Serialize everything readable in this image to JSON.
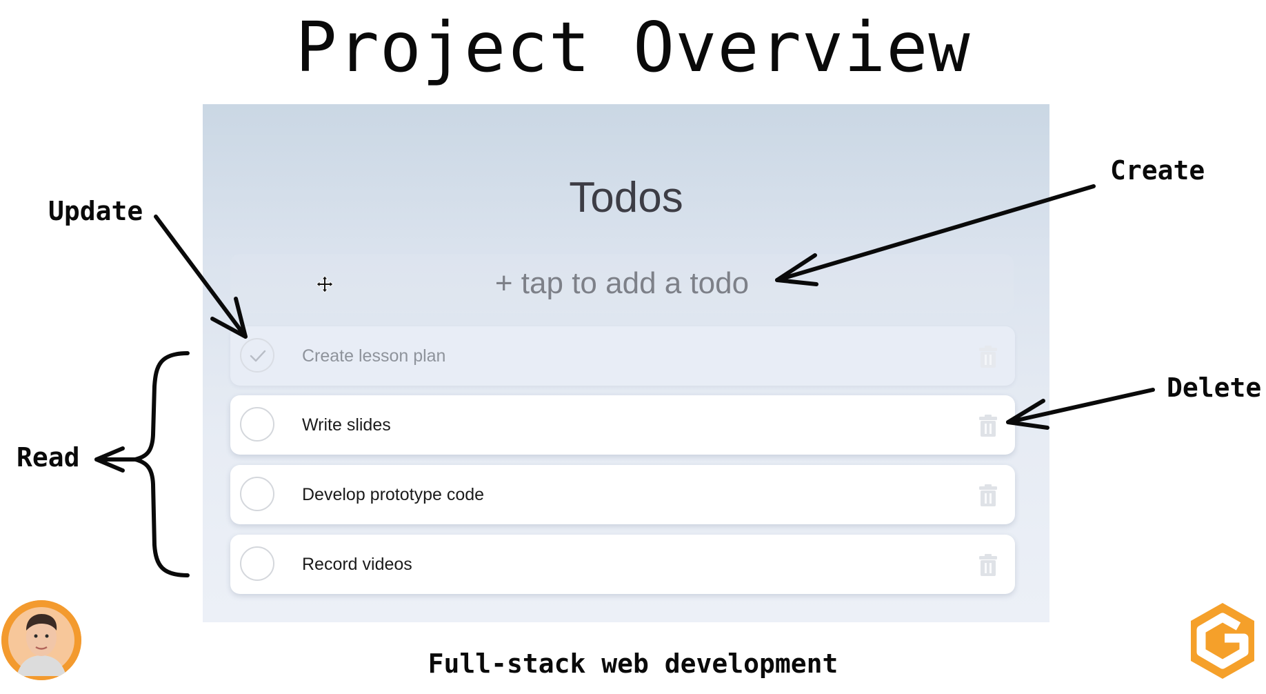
{
  "slide": {
    "title": "Project Overview",
    "footer": "Full-stack web development"
  },
  "app": {
    "title": "Todos",
    "add_placeholder": "+ tap to add a todo",
    "todos": [
      {
        "label": "Create lesson plan",
        "done": true
      },
      {
        "label": "Write slides",
        "done": false
      },
      {
        "label": "Develop prototype code",
        "done": false
      },
      {
        "label": "Record videos",
        "done": false
      }
    ]
  },
  "annotations": {
    "update": "Update",
    "create": "Create",
    "read": "Read",
    "delete": "Delete"
  },
  "icons": {
    "checkbox": "check-circle-icon",
    "trash": "trash-icon",
    "cursor": "move-cursor-icon",
    "logo": "orange-g-logo",
    "avatar": "presenter-avatar"
  },
  "colors": {
    "panel_top": "#cad7e4",
    "panel_bottom": "#ecf0f7",
    "logo_orange": "#f5a02a",
    "avatar_ring": "#f39a2e"
  }
}
